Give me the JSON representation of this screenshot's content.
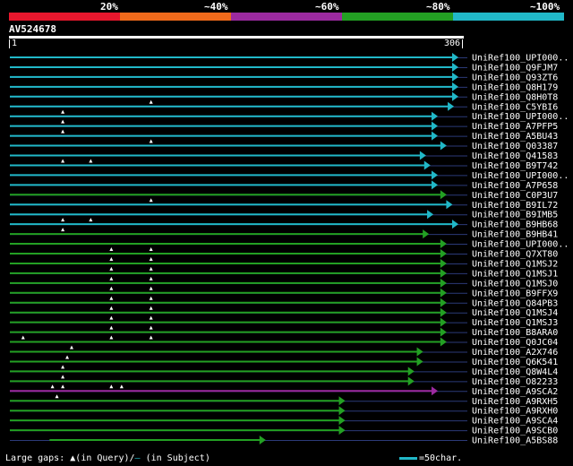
{
  "legend": {
    "segments": [
      "#e8172d",
      "#f06a1b",
      "#9c2aa0",
      "#23a023",
      "#21b8c8"
    ],
    "labels": [
      "20%",
      "~40%",
      "~60%",
      "~80%",
      "~100%"
    ]
  },
  "query": {
    "name": "AV524678",
    "start": "1",
    "end": "306"
  },
  "colors": {
    "cyan": "#21b8c8",
    "green": "#23a023",
    "purple": "#9c2aa0",
    "line": "#2b3a78"
  },
  "hits": [
    {
      "label": "UniRef100_UPI000..",
      "start": 1,
      "end": 306,
      "color": "cyan",
      "gaps": []
    },
    {
      "label": "UniRef100_Q9FJM7",
      "start": 1,
      "end": 306,
      "color": "cyan",
      "gaps": []
    },
    {
      "label": "UniRef100_Q93ZT6",
      "start": 1,
      "end": 306,
      "color": "cyan",
      "gaps": []
    },
    {
      "label": "UniRef100_Q8H179",
      "start": 1,
      "end": 306,
      "color": "cyan",
      "gaps": []
    },
    {
      "label": "UniRef100_Q8H0T8",
      "start": 1,
      "end": 306,
      "color": "cyan",
      "gaps": []
    },
    {
      "label": "UniRef100_C5YBI6",
      "start": 1,
      "end": 303,
      "color": "cyan",
      "gaps": [
        97
      ]
    },
    {
      "label": "UniRef100_UPI000..",
      "start": 1,
      "end": 292,
      "color": "cyan",
      "gaps": [
        37
      ]
    },
    {
      "label": "UniRef100_A7PFP5",
      "start": 1,
      "end": 292,
      "color": "cyan",
      "gaps": [
        37
      ]
    },
    {
      "label": "UniRef100_A5BU43",
      "start": 1,
      "end": 292,
      "color": "cyan",
      "gaps": [
        37
      ]
    },
    {
      "label": "UniRef100_Q03387",
      "start": 1,
      "end": 298,
      "color": "cyan",
      "gaps": [
        97
      ]
    },
    {
      "label": "UniRef100_Q41583",
      "start": 1,
      "end": 284,
      "color": "cyan",
      "gaps": []
    },
    {
      "label": "UniRef100_B9T742",
      "start": 1,
      "end": 287,
      "color": "cyan",
      "gaps": [
        37,
        56
      ]
    },
    {
      "label": "UniRef100_UPI000..",
      "start": 1,
      "end": 292,
      "color": "cyan",
      "gaps": []
    },
    {
      "label": "UniRef100_A7P658",
      "start": 1,
      "end": 292,
      "color": "cyan",
      "gaps": []
    },
    {
      "label": "UniRef100_C0P3U7",
      "start": 1,
      "end": 298,
      "color": "green",
      "gaps": []
    },
    {
      "label": "UniRef100_B9IL72",
      "start": 1,
      "end": 302,
      "color": "cyan",
      "gaps": [
        97
      ]
    },
    {
      "label": "UniRef100_B9IMB5",
      "start": 1,
      "end": 289,
      "color": "cyan",
      "gaps": []
    },
    {
      "label": "UniRef100_B9HB68",
      "start": 1,
      "end": 306,
      "color": "cyan",
      "gaps": [
        37,
        56
      ]
    },
    {
      "label": "UniRef100_B9HB41",
      "start": 1,
      "end": 286,
      "color": "green",
      "gaps": [
        37
      ]
    },
    {
      "label": "UniRef100_UPI000..",
      "start": 1,
      "end": 298,
      "color": "green",
      "gaps": []
    },
    {
      "label": "UniRef100_Q7XT80",
      "start": 1,
      "end": 298,
      "color": "green",
      "gaps": [
        70,
        97
      ]
    },
    {
      "label": "UniRef100_Q1MSJ2",
      "start": 1,
      "end": 298,
      "color": "green",
      "gaps": [
        70,
        97
      ]
    },
    {
      "label": "UniRef100_Q1MSJ1",
      "start": 1,
      "end": 298,
      "color": "green",
      "gaps": [
        70,
        97
      ]
    },
    {
      "label": "UniRef100_Q1MSJ0",
      "start": 1,
      "end": 298,
      "color": "green",
      "gaps": [
        70,
        97
      ]
    },
    {
      "label": "UniRef100_B9FFX9",
      "start": 1,
      "end": 298,
      "color": "green",
      "gaps": [
        70,
        97
      ]
    },
    {
      "label": "UniRef100_Q84PB3",
      "start": 1,
      "end": 298,
      "color": "green",
      "gaps": [
        70,
        97
      ]
    },
    {
      "label": "UniRef100_Q1MSJ4",
      "start": 1,
      "end": 298,
      "color": "green",
      "gaps": [
        70,
        97
      ]
    },
    {
      "label": "UniRef100_Q1MSJ3",
      "start": 1,
      "end": 298,
      "color": "green",
      "gaps": [
        70,
        97
      ]
    },
    {
      "label": "UniRef100_B8ARA0",
      "start": 1,
      "end": 298,
      "color": "green",
      "gaps": [
        70,
        97
      ]
    },
    {
      "label": "UniRef100_Q0JC04",
      "start": 1,
      "end": 298,
      "color": "green",
      "gaps": [
        10,
        70,
        97
      ]
    },
    {
      "label": "UniRef100_A2X746",
      "start": 1,
      "end": 282,
      "color": "green",
      "gaps": [
        43
      ]
    },
    {
      "label": "UniRef100_Q6K541",
      "start": 1,
      "end": 282,
      "color": "green",
      "gaps": [
        40
      ]
    },
    {
      "label": "UniRef100_Q8W4L4",
      "start": 1,
      "end": 276,
      "color": "green",
      "gaps": [
        37
      ]
    },
    {
      "label": "UniRef100_O82233",
      "start": 1,
      "end": 276,
      "color": "green",
      "gaps": [
        37
      ]
    },
    {
      "label": "UniRef100_A9SCA2",
      "start": 1,
      "end": 292,
      "color": "purple",
      "gaps": [
        30,
        37,
        70,
        77
      ]
    },
    {
      "label": "UniRef100_A9RXH5",
      "start": 1,
      "end": 229,
      "color": "green",
      "gaps": [
        33
      ]
    },
    {
      "label": "UniRef100_A9RXH0",
      "start": 1,
      "end": 229,
      "color": "green",
      "gaps": []
    },
    {
      "label": "UniRef100_A9SCA4",
      "start": 1,
      "end": 229,
      "color": "green",
      "gaps": []
    },
    {
      "label": "UniRef100_A9SCB0",
      "start": 1,
      "end": 229,
      "color": "green",
      "gaps": []
    },
    {
      "label": "UniRef100_A5BS88",
      "start": 28,
      "end": 175,
      "color": "green",
      "gaps": []
    }
  ],
  "footer": {
    "large_gaps_label": "Large gaps:",
    "in_query": "(in Query)/",
    "in_subject": "(in Subject)",
    "scale_label": "=50char."
  }
}
